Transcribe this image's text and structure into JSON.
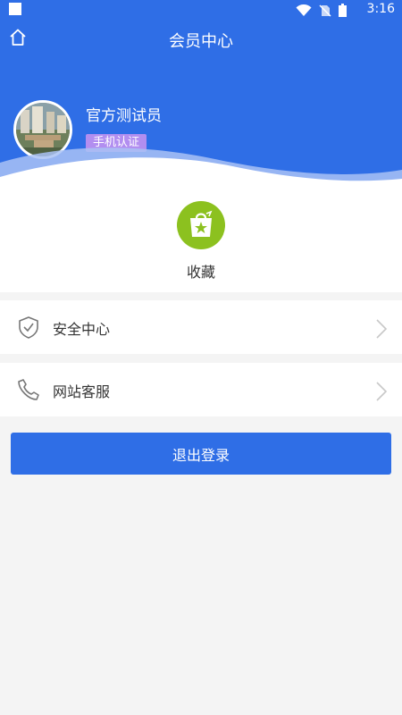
{
  "status_bar": {
    "time": "3:16"
  },
  "header": {
    "title": "会员中心",
    "home_icon": "home-icon"
  },
  "profile": {
    "name": "官方测试员",
    "badge": "手机认证"
  },
  "favorites": {
    "label": "收藏",
    "icon": "shopping-bag-star-icon"
  },
  "menu": [
    {
      "label": "安全中心",
      "icon": "shield-check-icon"
    },
    {
      "label": "网站客服",
      "icon": "phone-icon"
    }
  ],
  "logout_label": "退出登录",
  "colors": {
    "primary": "#2f6ee6",
    "favorite": "#8cc11f",
    "badge": "#b28ef0",
    "background": "#f4f4f4"
  }
}
